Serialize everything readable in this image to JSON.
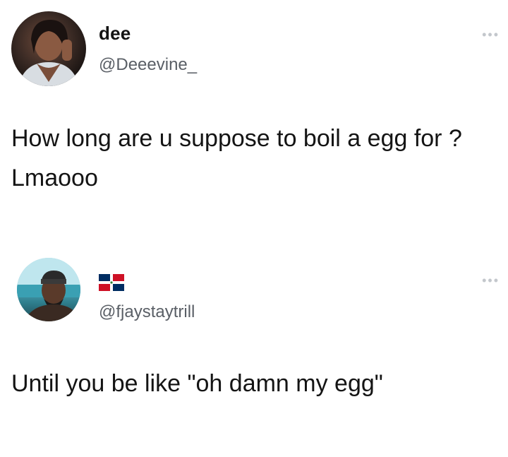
{
  "tweets": [
    {
      "display_name": "dee",
      "handle": "@Deeevine_",
      "text": "How long are u suppose to boil a egg for ? Lmaooo",
      "more_icon": "more-horizontal-icon"
    },
    {
      "display_name_flag": "dominican-republic-flag-icon",
      "handle": "@fjaystaytrill",
      "text": "Until you be like \"oh damn my egg\"",
      "more_icon": "more-horizontal-icon"
    }
  ],
  "colors": {
    "text": "#141414",
    "secondary_text": "#5a5f66",
    "muted_icon": "#c3c7cc",
    "background": "#ffffff",
    "flag_blue": "#002d62",
    "flag_red": "#ce1126"
  }
}
